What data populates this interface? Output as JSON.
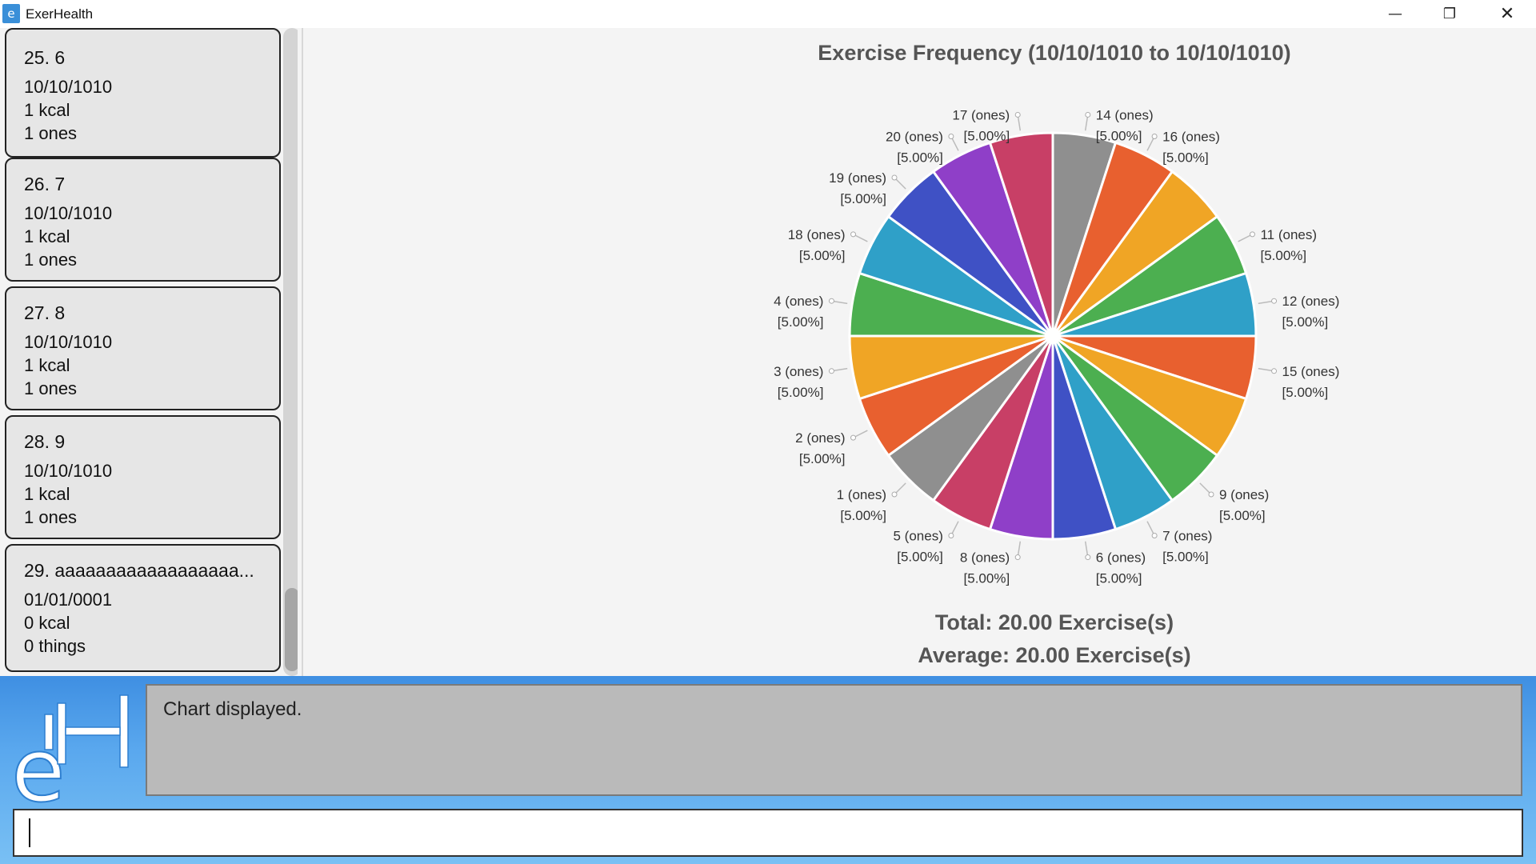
{
  "window": {
    "title": "ExerHealth",
    "icon": "app-logo-icon"
  },
  "exercise_list": [
    {
      "title": "25.  6",
      "date": "10/10/1010",
      "calories": "1 kcal",
      "quantity": "1 ones"
    },
    {
      "title": "26.  7",
      "date": "10/10/1010",
      "calories": "1 kcal",
      "quantity": "1 ones"
    },
    {
      "title": "27.  8",
      "date": "10/10/1010",
      "calories": "1 kcal",
      "quantity": "1 ones"
    },
    {
      "title": "28.  9",
      "date": "10/10/1010",
      "calories": "1 kcal",
      "quantity": "1 ones"
    },
    {
      "title": "29.  aaaaaaaaaaaaaaaaaa...",
      "date": "01/01/0001",
      "calories": "0 kcal",
      "quantity": "0 things"
    }
  ],
  "chart": {
    "total": "Total: 20.00 Exercise(s)",
    "average": "Average: 20.00 Exercise(s)"
  },
  "chart_data": {
    "type": "pie",
    "title": "Exercise Frequency (10/10/1010 to 10/10/1010)",
    "slices": [
      {
        "label": "14 (ones)",
        "percent_label": "[5.00%]",
        "value": 5,
        "color": "#8f8f8f"
      },
      {
        "label": "16 (ones)",
        "percent_label": "[5.00%]",
        "value": 5,
        "color": "#e8602f"
      },
      {
        "label": "",
        "percent_label": "",
        "value": 5,
        "color": "#f0a525"
      },
      {
        "label": "11 (ones)",
        "percent_label": "[5.00%]",
        "value": 5,
        "color": "#4caf50"
      },
      {
        "label": "12 (ones)",
        "percent_label": "[5.00%]",
        "value": 5,
        "color": "#2fa0c8"
      },
      {
        "label": "15 (ones)",
        "percent_label": "[5.00%]",
        "value": 5,
        "color": "#e8602f"
      },
      {
        "label": "",
        "percent_label": "",
        "value": 5,
        "color": "#f0a525"
      },
      {
        "label": "9 (ones)",
        "percent_label": "[5.00%]",
        "value": 5,
        "color": "#4caf50"
      },
      {
        "label": "7 (ones)",
        "percent_label": "[5.00%]",
        "value": 5,
        "color": "#2fa0c8"
      },
      {
        "label": "6 (ones)",
        "percent_label": "[5.00%]",
        "value": 5,
        "color": "#3f51c5"
      },
      {
        "label": "8 (ones)",
        "percent_label": "[5.00%]",
        "value": 5,
        "color": "#8f3fc8"
      },
      {
        "label": "5 (ones)",
        "percent_label": "[5.00%]",
        "value": 5,
        "color": "#c83f66"
      },
      {
        "label": "1 (ones)",
        "percent_label": "[5.00%]",
        "value": 5,
        "color": "#8f8f8f"
      },
      {
        "label": "2 (ones)",
        "percent_label": "[5.00%]",
        "value": 5,
        "color": "#e8602f"
      },
      {
        "label": "3 (ones)",
        "percent_label": "[5.00%]",
        "value": 5,
        "color": "#f0a525"
      },
      {
        "label": "4 (ones)",
        "percent_label": "[5.00%]",
        "value": 5,
        "color": "#4caf50"
      },
      {
        "label": "18 (ones)",
        "percent_label": "[5.00%]",
        "value": 5,
        "color": "#2fa0c8"
      },
      {
        "label": "19 (ones)",
        "percent_label": "[5.00%]",
        "value": 5,
        "color": "#3f51c5"
      },
      {
        "label": "20 (ones)",
        "percent_label": "[5.00%]",
        "value": 5,
        "color": "#8f3fc8"
      },
      {
        "label": "17 (ones)",
        "percent_label": "[5.00%]",
        "value": 5,
        "color": "#c83f66"
      }
    ],
    "legend": "none"
  },
  "result_display": {
    "text": "Chart displayed."
  },
  "command_box": {
    "value": "",
    "placeholder": ""
  }
}
